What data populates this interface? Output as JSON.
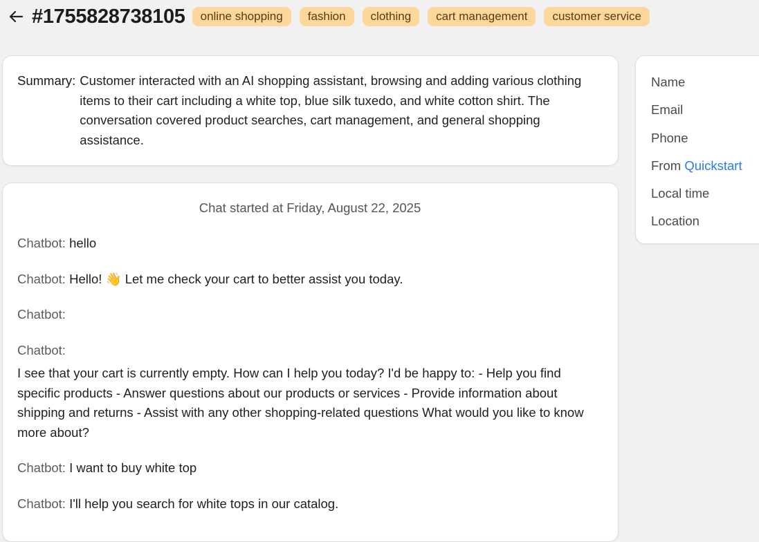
{
  "header": {
    "conversation_id": "#1755828738105",
    "tags": [
      "online shopping",
      "fashion",
      "clothing",
      "cart management",
      "customer service"
    ]
  },
  "summary": {
    "label": "Summary:",
    "text": "Customer interacted with an AI shopping assistant, browsing and adding various clothing items to their cart including a white top, blue silk tuxedo, and white cotton shirt. The conversation covered product searches, cart management, and general shopping assistance."
  },
  "chat": {
    "started": "Chat started at Friday, August 22, 2025",
    "messages": [
      {
        "sender": "Chatbot:",
        "text": "hello"
      },
      {
        "sender": "Chatbot:",
        "text": "Hello! 👋 Let me check your cart to better assist you today."
      },
      {
        "sender": "Chatbot:",
        "text": ""
      },
      {
        "sender": "Chatbot:",
        "text": "I see that your cart is currently empty. How can I help you today? I'd be happy to: - Help you find specific products - Answer questions about our products or services - Provide information about shipping and returns - Assist with any other shopping-related questions What would you like to know more about?"
      },
      {
        "sender": "Chatbot:",
        "text": "I want to buy white top"
      },
      {
        "sender": "Chatbot:",
        "text": "I'll help you search for white tops in our catalog."
      }
    ]
  },
  "contact": {
    "name_label": "Name",
    "email_label": "Email",
    "phone_label": "Phone",
    "from_label": "From",
    "from_value": "Quickstart",
    "local_time_label": "Local time",
    "location_label": "Location"
  },
  "colors": {
    "tag_background": "#fdd79b",
    "link": "#2d7be5",
    "page_background": "#f1f1f1"
  },
  "icons": {
    "back": "arrow-left-icon"
  }
}
